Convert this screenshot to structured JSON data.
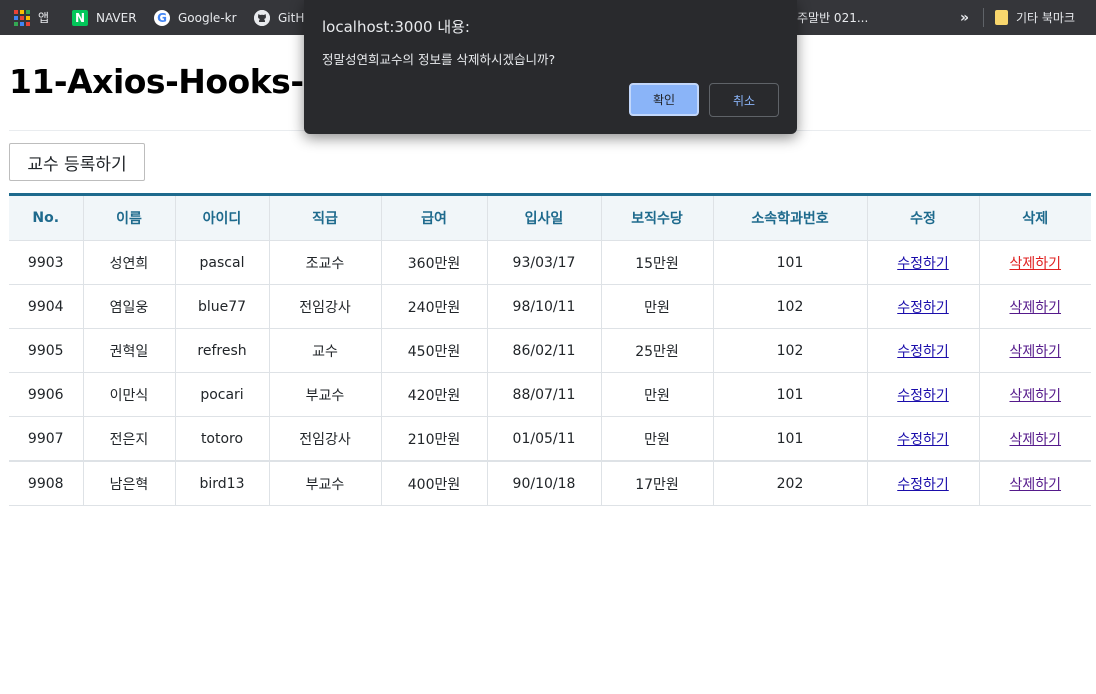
{
  "bookmarks": {
    "items": [
      {
        "label": "앱",
        "icon": "apps-grid-icon"
      },
      {
        "label": "NAVER",
        "icon": "naver-icon",
        "glyph": "N"
      },
      {
        "label": "Google-kr",
        "icon": "google-icon",
        "glyph": "G"
      },
      {
        "label": "GitH",
        "icon": "github-icon"
      },
      {
        "label": "주말반 021...",
        "icon": "bookmark-icon"
      }
    ],
    "more": "»",
    "other_bookmarks": "기타 북마크"
  },
  "page": {
    "title": "11-Axios-Hooks-C",
    "register_button": "교수 등록하기"
  },
  "table": {
    "headers": [
      "No.",
      "이름",
      "아이디",
      "직급",
      "급여",
      "입사일",
      "보직수당",
      "소속학과번호",
      "수정",
      "삭제"
    ],
    "rows": [
      [
        "9903",
        "성연희",
        "pascal",
        "조교수",
        "360만원",
        "93/03/17",
        "15만원",
        "101",
        "수정하기",
        "삭제하기"
      ],
      [
        "9904",
        "염일웅",
        "blue77",
        "전임강사",
        "240만원",
        "98/10/11",
        "만원",
        "102",
        "수정하기",
        "삭제하기"
      ],
      [
        "9905",
        "권혁일",
        "refresh",
        "교수",
        "450만원",
        "86/02/11",
        "25만원",
        "102",
        "수정하기",
        "삭제하기"
      ],
      [
        "9906",
        "이만식",
        "pocari",
        "부교수",
        "420만원",
        "88/07/11",
        "만원",
        "101",
        "수정하기",
        "삭제하기"
      ],
      [
        "9907",
        "전은지",
        "totoro",
        "전임강사",
        "210만원",
        "01/05/11",
        "만원",
        "101",
        "수정하기",
        "삭제하기"
      ],
      [
        "9908",
        "남은혁",
        "bird13",
        "부교수",
        "400만원",
        "90/10/18",
        "17만원",
        "202",
        "수정하기",
        "삭제하기"
      ]
    ]
  },
  "dialog": {
    "title": "localhost:3000 내용:",
    "message": "정말성연희교수의 정보를 삭제하시겠습니까?",
    "ok_label": "확인",
    "cancel_label": "취소"
  },
  "colors": {
    "accent": "#1e6a8d",
    "header_bg": "#f1f6f9",
    "dialog_bg": "#292a2d",
    "dialog_ok": "#8ab4f8",
    "active_delete_link": "#e02020"
  }
}
